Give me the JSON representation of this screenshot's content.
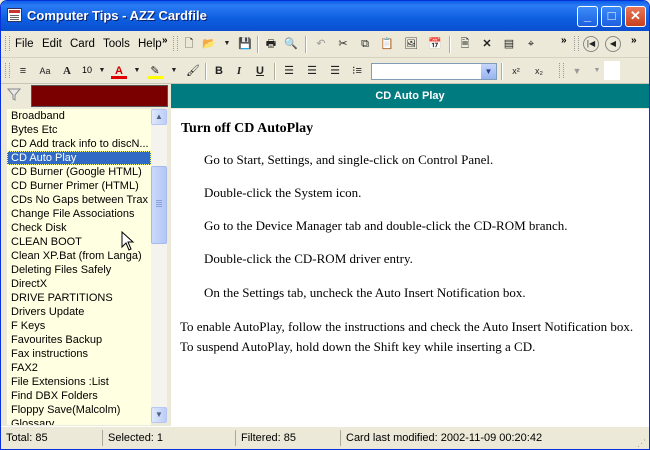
{
  "window": {
    "title": "Computer Tips - AZZ Cardfile"
  },
  "title_buttons": {
    "minimize": "_",
    "maximize": "□",
    "close": "✕"
  },
  "menu": [
    "File",
    "Edit",
    "Card",
    "Tools",
    "Help"
  ],
  "toolbar": {
    "font_size": "10"
  },
  "card_list": {
    "items": [
      "Broadband",
      "Bytes Etc",
      "CD Add track info to discN...",
      "CD Auto Play",
      "CD Burner (Google HTML)",
      "CD Burner Primer (HTML)",
      "CDs No Gaps between Trax",
      "Change File Associations",
      "Check Disk",
      "CLEAN BOOT",
      "Clean XP.Bat (from Langa)",
      "Deleting Files Safely",
      "DirectX",
      "DRIVE PARTITIONS",
      "Drivers Update",
      "F Keys",
      "Favourites Backup",
      "Fax instructions",
      "FAX2",
      "File Extensions :List",
      "Find DBX Folders",
      "Floppy Save(Malcolm)",
      "Glossary"
    ],
    "selected_index": 3
  },
  "card": {
    "header": "CD Auto Play",
    "title": "Turn off CD AutoPlay",
    "steps": [
      "Go to Start, Settings, and single-click on Control Panel.",
      "Double-click the System icon.",
      "Go to the Device Manager tab and double-click the CD-ROM branch.",
      "Double-click the CD-ROM driver entry.",
      "On the Settings tab, uncheck the Auto Insert Notification box."
    ],
    "note": "To enable AutoPlay, follow the instructions and check the Auto Insert Notification box. To suspend AutoPlay, hold down the Shift key while inserting a CD."
  },
  "status": {
    "total": "Total: 85",
    "selected": "Selected: 1",
    "filtered": "Filtered: 85",
    "modified": "Card last modified: 2002-11-09  00:20:42"
  }
}
